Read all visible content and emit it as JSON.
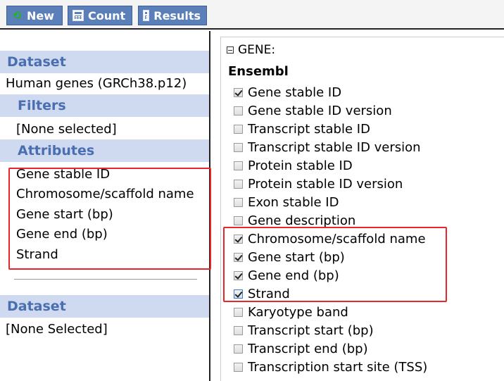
{
  "toolbar": {
    "new_label": "New",
    "count_label": "Count",
    "results_label": "Results"
  },
  "left": {
    "dataset_header": "Dataset",
    "dataset_value": "Human genes (GRCh38.p12)",
    "filters_header": "Filters",
    "filters_value": "[None selected]",
    "attributes_header": "Attributes",
    "attributes": [
      "Gene stable ID",
      "Chromosome/scaffold name",
      "Gene start (bp)",
      "Gene end (bp)",
      "Strand"
    ],
    "dataset2_header": "Dataset",
    "dataset2_value": "[None Selected]"
  },
  "right": {
    "section_label": "GENE:",
    "group_label": "Ensembl",
    "options": [
      {
        "label": "Gene stable ID",
        "checked": true
      },
      {
        "label": "Gene stable ID version",
        "checked": false
      },
      {
        "label": "Transcript stable ID",
        "checked": false
      },
      {
        "label": "Transcript stable ID version",
        "checked": false
      },
      {
        "label": "Protein stable ID",
        "checked": false
      },
      {
        "label": "Protein stable ID version",
        "checked": false
      },
      {
        "label": "Exon stable ID",
        "checked": false
      },
      {
        "label": "Gene description",
        "checked": false
      },
      {
        "label": "Chromosome/scaffold name",
        "checked": true
      },
      {
        "label": "Gene start (bp)",
        "checked": true
      },
      {
        "label": "Gene end (bp)",
        "checked": true
      },
      {
        "label": "Strand",
        "checked": true
      },
      {
        "label": "Karyotype band",
        "checked": false
      },
      {
        "label": "Transcript start (bp)",
        "checked": false
      },
      {
        "label": "Transcript end (bp)",
        "checked": false
      },
      {
        "label": "Transcription start site (TSS)",
        "checked": false
      }
    ]
  },
  "colors": {
    "button_bg": "#5b7fb9",
    "header_bg": "#cfd9f0",
    "header_text": "#4a6fb0",
    "highlight_box": "#e5262b"
  }
}
